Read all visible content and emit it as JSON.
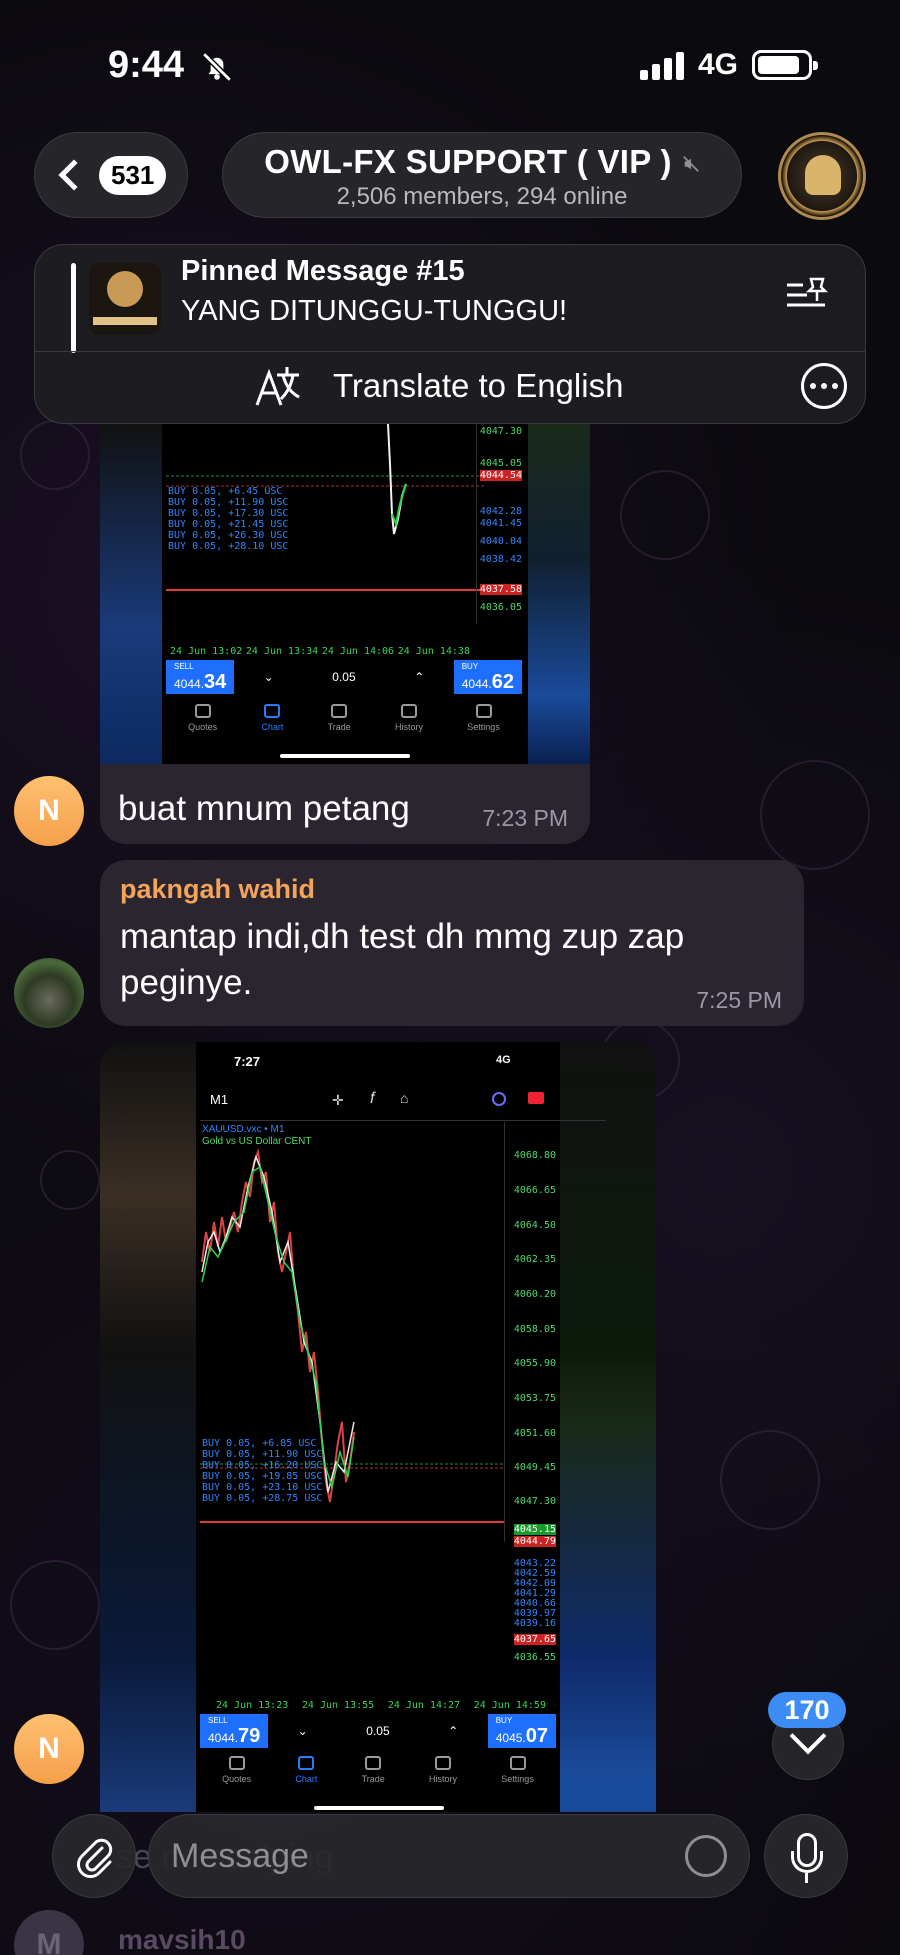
{
  "status_bar": {
    "time": "9:44",
    "network": "4G"
  },
  "header": {
    "back_count": "531",
    "title": "OWL-FX SUPPORT ( VIP )",
    "subtitle": "2,506 members, 294 online"
  },
  "pinned": {
    "title": "Pinned Message #15",
    "text": "YANG DITUNGGU-TUNGGU!",
    "thumb_label": "OWL ALGO INDICATOR",
    "translate_label": "Translate to English"
  },
  "chart1": {
    "price_labels": [
      "4047.30",
      "4045.05",
      "4044.54",
      "4042.28",
      "4041.45",
      "4040.04",
      "4038.42",
      "4037.58",
      "4036.05"
    ],
    "buy_lines": [
      "BUY 0.05, +6.45 USC",
      "BUY 0.05, +11.90 USC",
      "BUY 0.05, +17.30 USC",
      "BUY 0.05, +21.45 USC",
      "BUY 0.05, +26.30 USC",
      "BUY 0.05, +28.10 USC"
    ],
    "time_labels": [
      "24 Jun 13:02",
      "24 Jun 13:34",
      "24 Jun 14:06",
      "24 Jun 14:38"
    ],
    "sell_label": "SELL",
    "sell_price_main": "4044.",
    "sell_price_big": "34",
    "lot": "0.05",
    "buy_label": "BUY",
    "buy_price_main": "4044.",
    "buy_price_big": "62",
    "tabs": [
      "Quotes",
      "Chart",
      "Trade",
      "History",
      "Settings"
    ]
  },
  "messages": [
    {
      "avatar": "N",
      "text": "buat mnum petang",
      "time": "7:23 PM"
    },
    {
      "sender": "pakngah wahid",
      "text": "mantap indi,dh test dh mmg zup zap peginye.",
      "time": "7:25 PM"
    }
  ],
  "chart2": {
    "phone_time": "7:27",
    "phone_net": "4G",
    "timeframe": "M1",
    "symbol": "XAUUSD.vxc • M1",
    "symbol_desc": "Gold vs US Dollar CENT",
    "price_labels": [
      "4068.80",
      "4066.65",
      "4064.50",
      "4062.35",
      "4060.20",
      "4058.05",
      "4055.90",
      "4053.75",
      "4051.60",
      "4049.45",
      "4047.30",
      "4045.15",
      "4044.79",
      "4043.22",
      "4042.59",
      "4042.09",
      "4041.29",
      "4040.66",
      "4039.97",
      "4039.16",
      "4037.65",
      "4036.55"
    ],
    "buy_lines": [
      "BUY 0.05, +6.85 USC",
      "BUY 0.05, +11.90 USC",
      "BUY 0.05, +16.20 USC",
      "BUY 0.05, +19.85 USC",
      "BUY 0.05, +23.10 USC",
      "BUY 0.05, +28.75 USC"
    ],
    "time_labels": [
      "24 Jun 13:23",
      "24 Jun 13:55",
      "24 Jun 14:27",
      "24 Jun 14:59"
    ],
    "sell_label": "SELL",
    "sell_price_main": "4044.",
    "sell_price_big": "79",
    "lot": "0.05",
    "buy_label": "BUY",
    "buy_price_main": "4045.",
    "buy_price_big": "07",
    "tabs": [
      "Quotes",
      "Chart",
      "Trade",
      "History",
      "Settings"
    ]
  },
  "scroll": {
    "unread": "170"
  },
  "composer": {
    "placeholder": "Message"
  },
  "behind": {
    "text": "se               nd scalping",
    "sender": "mavsih10",
    "avatar": "M"
  },
  "colors": {
    "accent": "#3d8cf5",
    "sender": "#f4a35b",
    "bubble": "#2b2530"
  }
}
